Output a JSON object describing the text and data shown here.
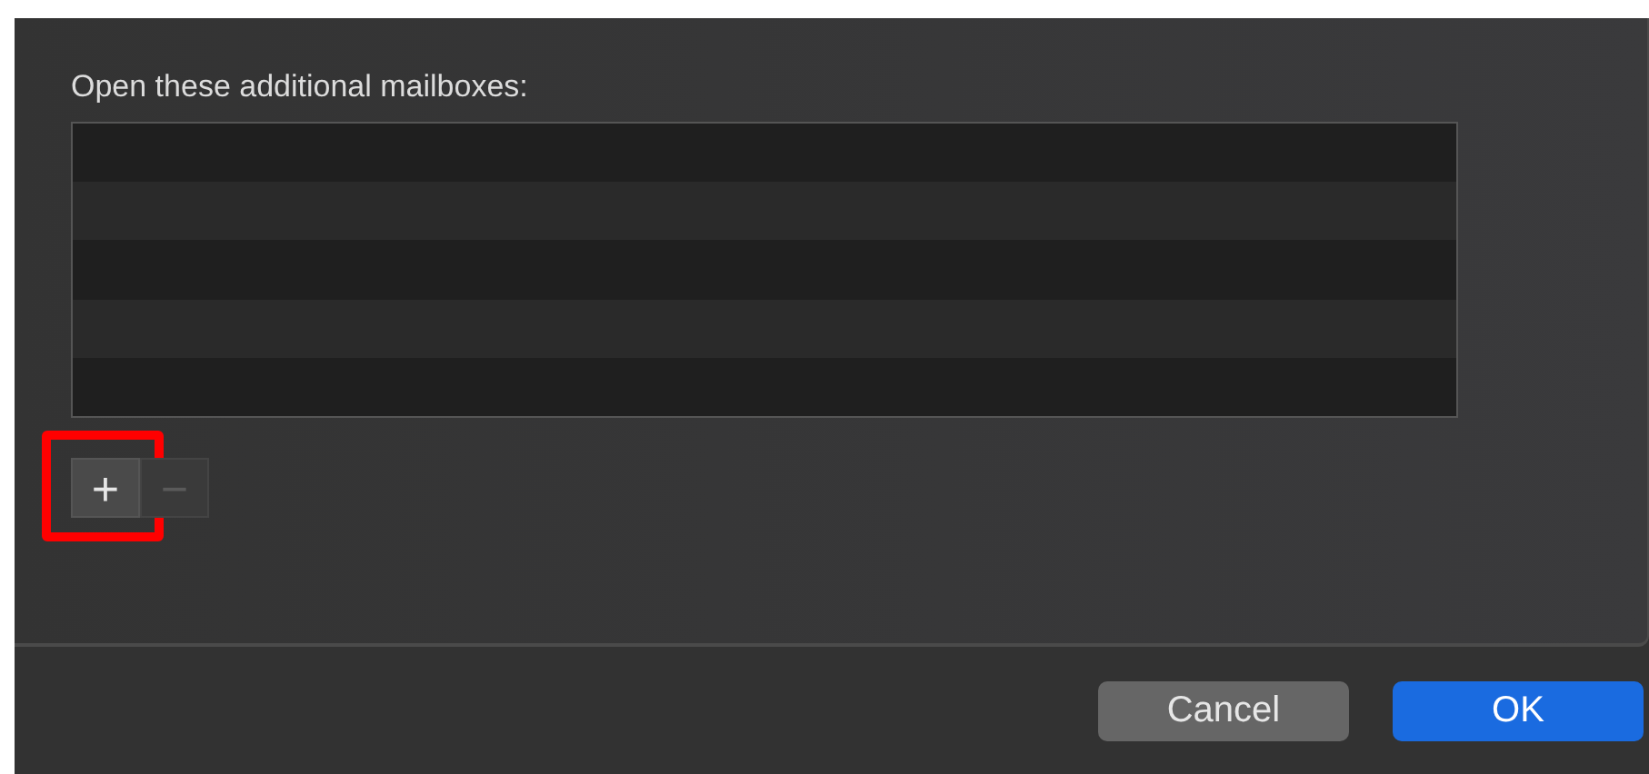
{
  "heading": "Open these additional mailboxes:",
  "list_buttons": [
    {
      "label": "+",
      "disabled": false,
      "highlighted": true
    },
    {
      "label": "−",
      "disabled": true,
      "highlighted": false
    }
  ],
  "buttons": [
    {
      "label": "Cancel",
      "kind": "secondary"
    },
    {
      "label": "OK",
      "kind": "primary"
    }
  ]
}
